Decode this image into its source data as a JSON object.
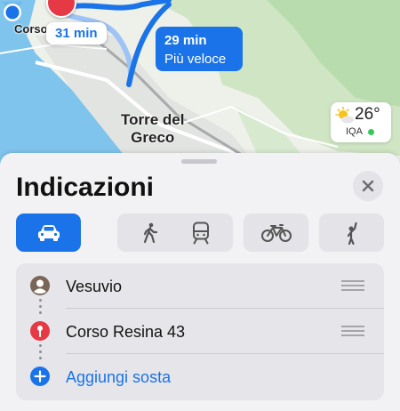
{
  "map": {
    "place_label_corso": "Corso",
    "place_label_torre_line1": "Torre del",
    "place_label_torre_line2": "Greco",
    "route_alt_time": "31 min",
    "route_main_time": "29 min",
    "route_main_note": "Più veloce",
    "weather": {
      "temperature": "26°",
      "aqi_label": "IQA",
      "aqi_color": "#34c759",
      "icon": "sun-cloud-icon"
    }
  },
  "sheet": {
    "title": "Indicazioni",
    "close_icon": "close-icon",
    "transport_modes": [
      {
        "name": "car",
        "icon": "car-icon",
        "active": true
      },
      {
        "name": "walk",
        "icon": "walk-icon",
        "active": false
      },
      {
        "name": "transit",
        "icon": "train-icon",
        "active": false
      },
      {
        "name": "bike",
        "icon": "bicycle-icon",
        "active": false
      },
      {
        "name": "rideshare",
        "icon": "person-wave-icon",
        "active": false
      }
    ],
    "stops": [
      {
        "label": "Vesuvio",
        "icon": "avatar-icon"
      },
      {
        "label": "Corso Resina 43",
        "icon": "red-pin-icon"
      },
      {
        "label": "Aggiungi sosta",
        "icon": "plus-icon"
      }
    ]
  },
  "colors": {
    "accent": "#1a73e8",
    "pin": "#e53945"
  }
}
